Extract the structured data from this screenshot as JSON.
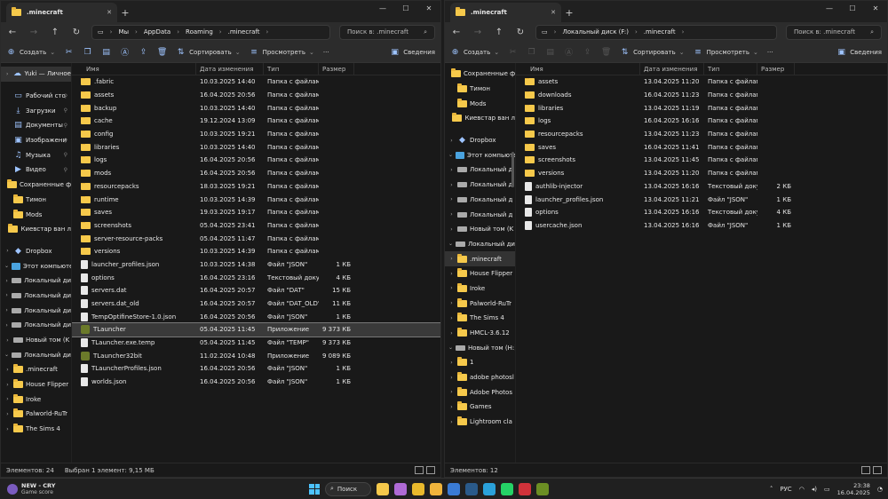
{
  "left": {
    "tab_title": ".minecraft",
    "breadcrumb": [
      "Мы",
      "AppData",
      "Roaming",
      ".minecraft"
    ],
    "search_placeholder": "Поиск в: .minecraft",
    "toolbar": {
      "create": "Создать",
      "sort": "Сортировать",
      "view": "Просмотреть",
      "more": "···",
      "details": "Сведения"
    },
    "columns": [
      "Имя",
      "Дата изменения",
      "Тип",
      "Размер"
    ],
    "sidebar": [
      {
        "label": "Yuki — Личное",
        "icon": "cloud-icon",
        "chev": "›",
        "sel": true
      },
      {
        "label": "Рабочий сто",
        "icon": "desktop-icon",
        "pin": true,
        "gap": true
      },
      {
        "label": "Загрузки",
        "icon": "download-icon",
        "pin": true
      },
      {
        "label": "Документы",
        "icon": "document-icon",
        "pin": true
      },
      {
        "label": "Изображени",
        "icon": "image-icon",
        "pin": true
      },
      {
        "label": "Музыка",
        "icon": "music-icon",
        "pin": true
      },
      {
        "label": "Видео",
        "icon": "video-icon",
        "pin": true
      },
      {
        "label": "Сохраненные ф",
        "icon": "folder-icon"
      },
      {
        "label": "Тимон",
        "icon": "folder-icon"
      },
      {
        "label": "Mods",
        "icon": "folder-icon"
      },
      {
        "label": "Киевстар ван л",
        "icon": "folder-icon"
      },
      {
        "label": "Dropbox",
        "icon": "dropbox-icon",
        "chev": "›",
        "gap": true
      },
      {
        "label": "Этот компьюте",
        "icon": "pc-icon",
        "chev": "⌄"
      },
      {
        "label": "Локальный ди",
        "icon": "drive-icon",
        "chev": "›"
      },
      {
        "label": "Локальный ди",
        "icon": "drive-icon",
        "chev": "›"
      },
      {
        "label": "Локальный ди",
        "icon": "drive-icon",
        "chev": "›"
      },
      {
        "label": "Локальный ди",
        "icon": "drive-icon",
        "chev": "›"
      },
      {
        "label": "Новый том (K",
        "icon": "drive-icon",
        "chev": "›"
      },
      {
        "label": "Локальный дис",
        "icon": "drive-icon",
        "chev": "⌄"
      },
      {
        "label": ".minecraft",
        "icon": "folder-icon",
        "chev": "›"
      },
      {
        "label": "House Flipper",
        "icon": "folder-icon",
        "chev": "›"
      },
      {
        "label": "Iroke",
        "icon": "folder-icon",
        "chev": "›"
      },
      {
        "label": "Palworld-RuTr",
        "icon": "folder-icon",
        "chev": "›"
      },
      {
        "label": "The Sims 4",
        "icon": "folder-icon",
        "chev": "›"
      }
    ],
    "files": [
      {
        "name": ".fabric",
        "date": "10.03.2025 14:40",
        "type": "Папка с файлами",
        "size": "",
        "icon": "folder-icon"
      },
      {
        "name": "assets",
        "date": "16.04.2025 20:56",
        "type": "Папка с файлами",
        "size": "",
        "icon": "folder-icon"
      },
      {
        "name": "backup",
        "date": "10.03.2025 14:40",
        "type": "Папка с файлами",
        "size": "",
        "icon": "folder-icon"
      },
      {
        "name": "cache",
        "date": "19.12.2024 13:09",
        "type": "Папка с файлами",
        "size": "",
        "icon": "folder-icon"
      },
      {
        "name": "config",
        "date": "10.03.2025 19:21",
        "type": "Папка с файлами",
        "size": "",
        "icon": "folder-icon"
      },
      {
        "name": "libraries",
        "date": "10.03.2025 14:40",
        "type": "Папка с файлами",
        "size": "",
        "icon": "folder-icon"
      },
      {
        "name": "logs",
        "date": "16.04.2025 20:56",
        "type": "Папка с файлами",
        "size": "",
        "icon": "folder-icon"
      },
      {
        "name": "mods",
        "date": "16.04.2025 20:56",
        "type": "Папка с файлами",
        "size": "",
        "icon": "folder-icon"
      },
      {
        "name": "resourcepacks",
        "date": "18.03.2025 19:21",
        "type": "Папка с файлами",
        "size": "",
        "icon": "folder-icon"
      },
      {
        "name": "runtime",
        "date": "10.03.2025 14:39",
        "type": "Папка с файлами",
        "size": "",
        "icon": "folder-icon"
      },
      {
        "name": "saves",
        "date": "19.03.2025 19:17",
        "type": "Папка с файлами",
        "size": "",
        "icon": "folder-icon"
      },
      {
        "name": "screenshots",
        "date": "05.04.2025 23:41",
        "type": "Папка с файлами",
        "size": "",
        "icon": "folder-icon"
      },
      {
        "name": "server-resource-packs",
        "date": "05.04.2025 11:47",
        "type": "Папка с файлами",
        "size": "",
        "icon": "folder-icon"
      },
      {
        "name": "versions",
        "date": "10.03.2025 14:39",
        "type": "Папка с файлами",
        "size": "",
        "icon": "folder-icon"
      },
      {
        "name": "launcher_profiles.json",
        "date": "10.03.2025 14:38",
        "type": "Файл \"JSON\"",
        "size": "1 КБ",
        "icon": "file-icon"
      },
      {
        "name": "options",
        "date": "16.04.2025 23:16",
        "type": "Текстовый докум...",
        "size": "4 КБ",
        "icon": "file-icon"
      },
      {
        "name": "servers.dat",
        "date": "16.04.2025 20:57",
        "type": "Файл \"DAT\"",
        "size": "15 КБ",
        "icon": "file-icon"
      },
      {
        "name": "servers.dat_old",
        "date": "16.04.2025 20:57",
        "type": "Файл \"DAT_OLD\"",
        "size": "11 КБ",
        "icon": "file-icon"
      },
      {
        "name": "TempOptifineStore-1.0.json",
        "date": "16.04.2025 20:56",
        "type": "Файл \"JSON\"",
        "size": "1 КБ",
        "icon": "file-icon"
      },
      {
        "name": "TLauncher",
        "date": "05.04.2025 11:45",
        "type": "Приложение",
        "size": "9 373 КБ",
        "icon": "exe-icon",
        "sel": true
      },
      {
        "name": "TLauncher.exe.temp",
        "date": "05.04.2025 11:45",
        "type": "Файл \"TEMP\"",
        "size": "9 373 КБ",
        "icon": "file-icon"
      },
      {
        "name": "TLauncher32bit",
        "date": "11.02.2024 10:48",
        "type": "Приложение",
        "size": "9 089 КБ",
        "icon": "exe-icon"
      },
      {
        "name": "TLauncherProfiles.json",
        "date": "16.04.2025 20:56",
        "type": "Файл \"JSON\"",
        "size": "1 КБ",
        "icon": "file-icon"
      },
      {
        "name": "worlds.json",
        "date": "16.04.2025 20:56",
        "type": "Файл \"JSON\"",
        "size": "1 КБ",
        "icon": "file-icon"
      }
    ],
    "status": {
      "count": "Элементов: 24",
      "selected": "Выбран 1 элемент: 9,15 МБ"
    }
  },
  "right": {
    "tab_title": ".minecraft",
    "breadcrumb": [
      "Локальный диск (F:)",
      ".minecraft"
    ],
    "search_placeholder": "Поиск в: .minecraft",
    "toolbar": {
      "create": "Создать",
      "sort": "Сортировать",
      "view": "Просмотреть",
      "more": "···",
      "details": "Сведения"
    },
    "columns": [
      "Имя",
      "Дата изменения",
      "Тип",
      "Размер"
    ],
    "sidebar": [
      {
        "label": "Сохраненные ф",
        "icon": "folder-icon"
      },
      {
        "label": "Тимон",
        "icon": "folder-icon"
      },
      {
        "label": "Mods",
        "icon": "folder-icon"
      },
      {
        "label": "Киевстар ван л",
        "icon": "folder-icon"
      },
      {
        "label": "Dropbox",
        "icon": "dropbox-icon",
        "chev": "›",
        "gap": true
      },
      {
        "label": "Этот компьюте",
        "icon": "pc-icon",
        "chev": "⌄"
      },
      {
        "label": "Локальный д",
        "icon": "drive-icon",
        "chev": "›"
      },
      {
        "label": "Локальный д",
        "icon": "drive-icon",
        "chev": "›"
      },
      {
        "label": "Локальный д",
        "icon": "drive-icon",
        "chev": "›"
      },
      {
        "label": "Локальный д",
        "icon": "drive-icon",
        "chev": "›"
      },
      {
        "label": "Новый том (K",
        "icon": "drive-icon",
        "chev": "›"
      },
      {
        "label": "Локальный дис",
        "icon": "drive-icon",
        "chev": "⌄"
      },
      {
        "label": ".minecraft",
        "icon": "folder-icon",
        "chev": "›",
        "sel": true
      },
      {
        "label": "House Flipper",
        "icon": "folder-icon",
        "chev": "›"
      },
      {
        "label": "Iroke",
        "icon": "folder-icon",
        "chev": "›"
      },
      {
        "label": "Palworld-RuTr",
        "icon": "folder-icon",
        "chev": "›"
      },
      {
        "label": "The Sims 4",
        "icon": "folder-icon",
        "chev": "›"
      },
      {
        "label": "HMCL-3.6.12",
        "icon": "folder-icon",
        "chev": "›"
      },
      {
        "label": "Новый том (H:)",
        "icon": "drive-icon",
        "chev": "⌄"
      },
      {
        "label": "1",
        "icon": "folder-icon",
        "chev": "›"
      },
      {
        "label": "adobe photosl",
        "icon": "folder-icon",
        "chev": "›"
      },
      {
        "label": "Adobe Photos",
        "icon": "folder-icon",
        "chev": "›"
      },
      {
        "label": "Games",
        "icon": "folder-icon",
        "chev": "›"
      },
      {
        "label": "Lightroom cla",
        "icon": "folder-icon",
        "chev": "›"
      }
    ],
    "files": [
      {
        "name": "assets",
        "date": "13.04.2025 11:20",
        "type": "Папка с файлами",
        "size": "",
        "icon": "folder-icon"
      },
      {
        "name": "downloads",
        "date": "16.04.2025 11:23",
        "type": "Папка с файлами",
        "size": "",
        "icon": "folder-icon"
      },
      {
        "name": "libraries",
        "date": "13.04.2025 11:19",
        "type": "Папка с файлами",
        "size": "",
        "icon": "folder-icon"
      },
      {
        "name": "logs",
        "date": "16.04.2025 16:16",
        "type": "Папка с файлами",
        "size": "",
        "icon": "folder-icon"
      },
      {
        "name": "resourcepacks",
        "date": "13.04.2025 11:23",
        "type": "Папка с файлами",
        "size": "",
        "icon": "folder-icon"
      },
      {
        "name": "saves",
        "date": "16.04.2025 11:41",
        "type": "Папка с файлами",
        "size": "",
        "icon": "folder-icon"
      },
      {
        "name": "screenshots",
        "date": "13.04.2025 11:45",
        "type": "Папка с файлами",
        "size": "",
        "icon": "folder-icon"
      },
      {
        "name": "versions",
        "date": "13.04.2025 11:20",
        "type": "Папка с файлами",
        "size": "",
        "icon": "folder-icon"
      },
      {
        "name": "authlib-injector",
        "date": "13.04.2025 16:16",
        "type": "Текстовый докум...",
        "size": "2 КБ",
        "icon": "file-icon"
      },
      {
        "name": "launcher_profiles.json",
        "date": "13.04.2025 11:21",
        "type": "Файл \"JSON\"",
        "size": "1 КБ",
        "icon": "file-icon"
      },
      {
        "name": "options",
        "date": "13.04.2025 16:16",
        "type": "Текстовый докум...",
        "size": "4 КБ",
        "icon": "file-icon"
      },
      {
        "name": "usercache.json",
        "date": "13.04.2025 16:16",
        "type": "Файл \"JSON\"",
        "size": "1 КБ",
        "icon": "file-icon"
      }
    ],
    "status": {
      "count": "Элементов: 12",
      "selected": ""
    }
  },
  "taskbar": {
    "widget_title": "NEW - CRY",
    "widget_sub": "Game score",
    "search": "Поиск",
    "lang": "РУС",
    "time": "23:38",
    "date": "16.04.2025",
    "apps": [
      {
        "name": "file-explorer-app",
        "color": "#f6c94b"
      },
      {
        "name": "copilot-app",
        "color": "#b06bd6"
      },
      {
        "name": "chrome-app",
        "color": "#e9b92c"
      },
      {
        "name": "folder-app",
        "color": "#f0b43c"
      },
      {
        "name": "store-app",
        "color": "#3a7bd5"
      },
      {
        "name": "steam-app",
        "color": "#2a5a8a"
      },
      {
        "name": "telegram-app",
        "color": "#2aa1da"
      },
      {
        "name": "whatsapp-app",
        "color": "#25d366"
      },
      {
        "name": "media-app",
        "color": "#d0323a"
      },
      {
        "name": "minecraft-app",
        "color": "#6b8e23"
      }
    ]
  },
  "colors": {
    "accent": "#4cc2ff",
    "folder": "#f6c94b",
    "selection": "#3a3a3a"
  }
}
